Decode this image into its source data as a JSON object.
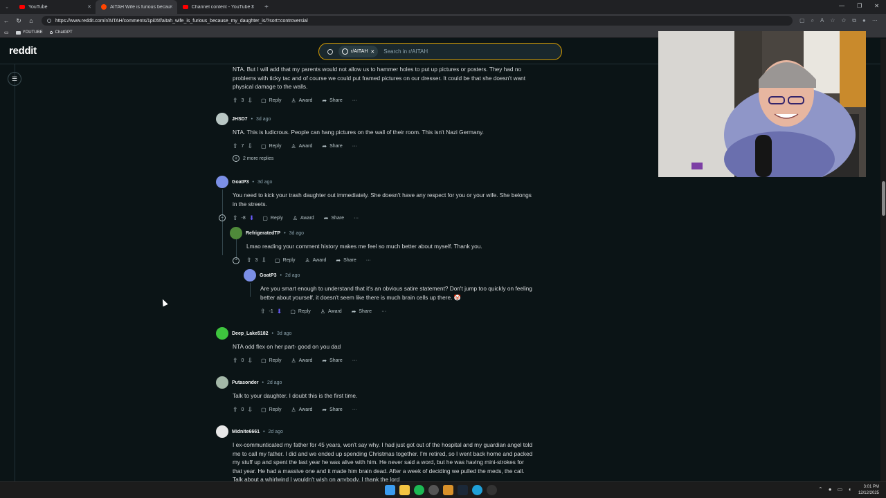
{
  "browser": {
    "tabs": [
      {
        "title": "YouTube",
        "icon": "youtube-icon"
      },
      {
        "title": "AITAH Wife is furious because my...",
        "icon": "reddit-icon"
      },
      {
        "title": "Channel content - YouTube Studio",
        "icon": "youtube-icon"
      }
    ],
    "url": "https://www.reddit.com/r/AITAH/comments/1pi05f/aitah_wife_is_furious_because_my_daughter_is/?sort=controversial",
    "bookmarks": [
      {
        "label": "YOUTUBE",
        "icon": "folder-icon"
      },
      {
        "label": "ChatGPT",
        "icon": "chatgpt-icon"
      }
    ]
  },
  "reddit": {
    "logo": "reddit",
    "search": {
      "subreddit_chip": "r/AITAH",
      "placeholder": "Search in r/AITAH"
    }
  },
  "labels": {
    "reply": "Reply",
    "award": "Award",
    "share": "Share",
    "more": "···",
    "sep": "•",
    "more_replies": "2 more replies"
  },
  "comments": [
    {
      "author": "",
      "time": "",
      "body": "NTA. But I will add that my parents would not allow us to hammer holes to put up pictures or posters. They had no problems with ticky tac and of course we could put framed pictures on our dresser. It could be that she doesn't want physical damage to the walls.",
      "score": "3"
    },
    {
      "author": "JHSD7",
      "time": "3d ago",
      "body": "NTA. This is ludicrous. People can hang pictures on the wall of their room. This isn't Nazi Germany.",
      "score": "7"
    },
    {
      "author": "GoatP3",
      "time": "3d ago",
      "body": "You need to kick your trash daughter out immediately. She doesn't have any respect for you or your wife. She belongs in the streets.",
      "score": "-8"
    },
    {
      "author": "RefrigeratedTP",
      "time": "3d ago",
      "body": "Lmao reading your comment history makes me feel so much better about myself. Thank you.",
      "score": "3"
    },
    {
      "author": "GoatP3",
      "time": "2d ago",
      "body": "Are you smart enough to understand that it's an obvious satire statement? Don't jump too quickly on feeling better about yourself, it doesn't seem like there is much brain cells up there. 🤡",
      "score": "-1"
    },
    {
      "author": "Deep_Lake5182",
      "time": "3d ago",
      "body": "NTA odd flex on her part- good on you dad",
      "score": "0"
    },
    {
      "author": "Putasonder",
      "time": "2d ago",
      "body": "Talk to your daughter. I doubt this is the first time.",
      "score": "0"
    },
    {
      "author": "Midnite6661",
      "time": "2d ago",
      "body": "I ex-communticated my father for 45 years, won't say why. I had just got out of the hospital and my guardian angel told me to call my father. I did and we ended up spending Christmas together. I'm retired, so I went back home and packed my stuff up and spent the last year he was alive with him. He never said a word, but he was having mini-strokes for that year. He had a massive one and it made him brain dead. After a week of deciding we pulled the meds, the call. Talk about a whirlwind I wouldn't wish on anybody. I thank the lord",
      "score": ""
    }
  ],
  "taskbar": {
    "time": "3:01 PM",
    "date": "12/12/2025"
  },
  "colors": {
    "background": "#0b1416",
    "accent_downvote": "#6a5cff",
    "search_border": "#d49b00"
  }
}
